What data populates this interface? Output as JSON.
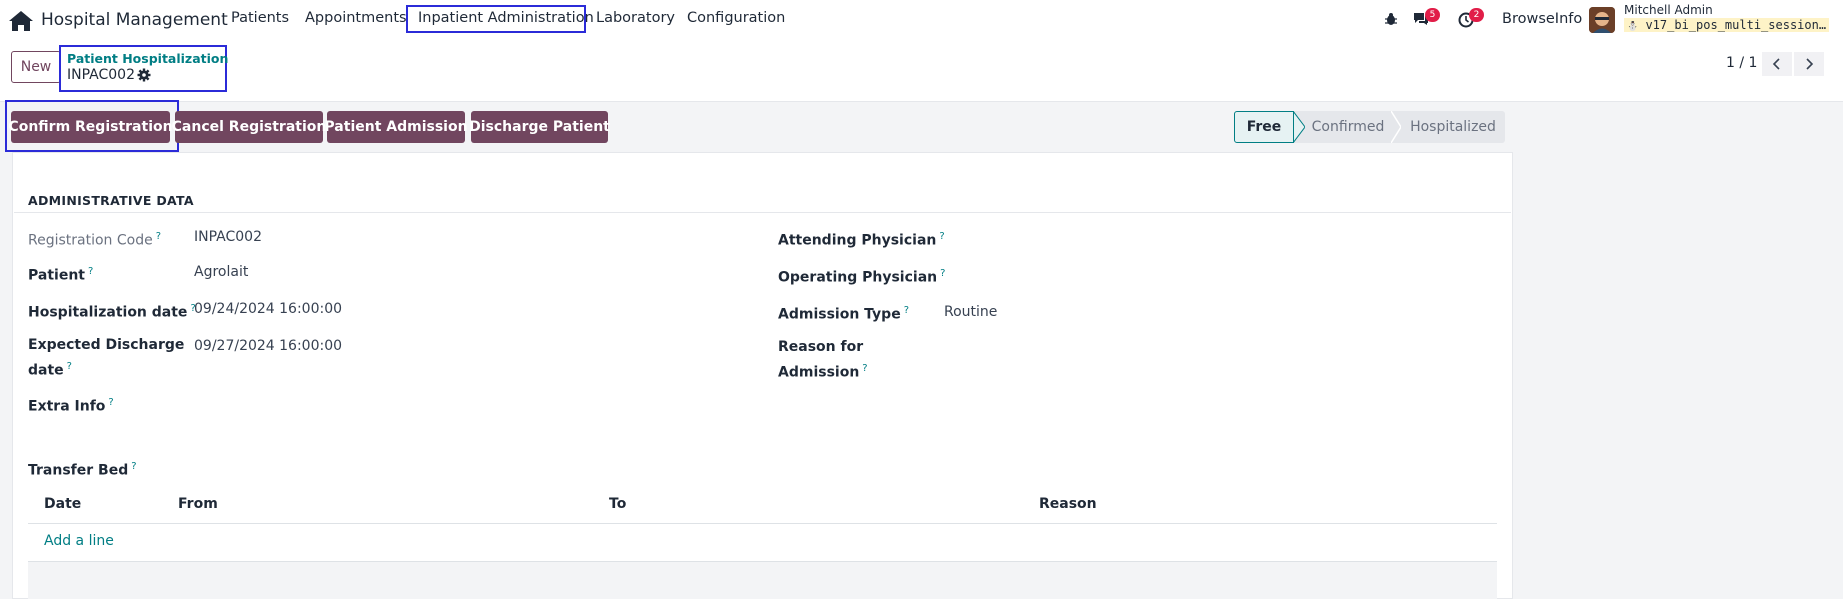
{
  "navbar": {
    "app_title": "Hospital Management",
    "menu": [
      "Patients",
      "Appointments",
      "Inpatient Administration",
      "Laboratory",
      "Configuration"
    ],
    "active_menu": "Inpatient Administration",
    "messages_count": "5",
    "activities_count": "2",
    "company": "BrowseInfo",
    "user_name": "Mitchell Admin",
    "database": "v17_bi_pos_multi_session…"
  },
  "control_panel": {
    "new_label": "New",
    "breadcrumb": "Patient Hospitalization",
    "record_name": "INPAC002",
    "pager": "1 / 1"
  },
  "actions": {
    "confirm": "Confirm Registration",
    "cancel": "Cancel Registration",
    "admit": "Patient Admission",
    "discharge": "Discharge Patient"
  },
  "statusbar": {
    "stages": [
      "Free",
      "Confirmed",
      "Hospitalized"
    ],
    "active": "Free"
  },
  "form": {
    "section_title": "ADMINISTRATIVE DATA",
    "left": {
      "registration_code_label": "Registration Code",
      "registration_code": "INPAC002",
      "patient_label": "Patient",
      "patient": "Agrolait",
      "hosp_date_label": "Hospitalization date",
      "hosp_date": "09/24/2024 16:00:00",
      "expected_discharge_label_1": "Expected Discharge",
      "expected_discharge_label_2": "date",
      "expected_discharge": "09/27/2024 16:00:00",
      "extra_info_label": "Extra Info"
    },
    "right": {
      "attending_label": "Attending Physician",
      "operating_label": "Operating Physician",
      "admission_type_label": "Admission Type",
      "admission_type": "Routine",
      "reason_label_1": "Reason for",
      "reason_label_2": "Admission"
    },
    "transfer_bed": {
      "label": "Transfer Bed",
      "columns": [
        "Date",
        "From",
        "To",
        "Reason"
      ],
      "add_line": "Add a line"
    }
  },
  "colors": {
    "primary": "#71465f",
    "link": "#017e84",
    "highlight": "#2b2bd8"
  },
  "help_mark": "?"
}
